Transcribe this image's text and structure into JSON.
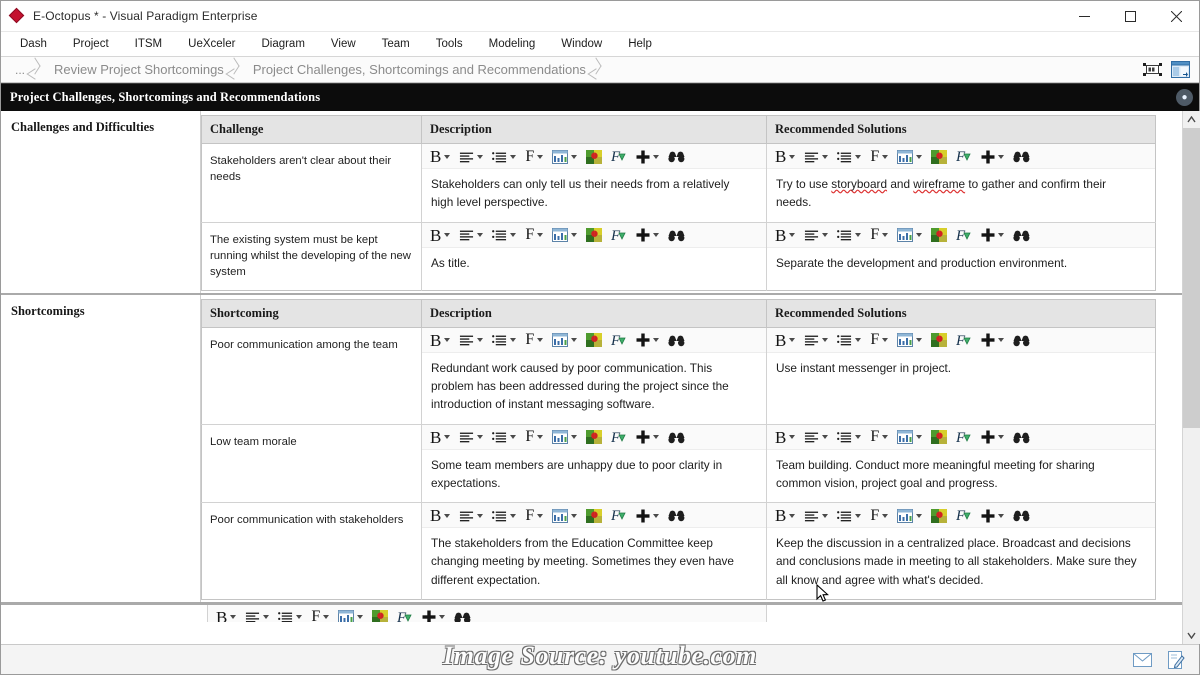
{
  "window": {
    "title": "E-Octopus * - Visual Paradigm Enterprise",
    "logo_icon": "visual-paradigm-diamond-icon",
    "minimize_label": "Minimize",
    "maximize_label": "Maximize",
    "close_label": "Close"
  },
  "menubar": {
    "items": [
      {
        "label": "Dash"
      },
      {
        "label": "Project"
      },
      {
        "label": "ITSM"
      },
      {
        "label": "UeXceler"
      },
      {
        "label": "Diagram"
      },
      {
        "label": "View"
      },
      {
        "label": "Team"
      },
      {
        "label": "Tools"
      },
      {
        "label": "Modeling"
      },
      {
        "label": "Window"
      },
      {
        "label": "Help"
      }
    ]
  },
  "breadcrumb": {
    "items": [
      {
        "label": "..."
      },
      {
        "label": "Review Project Shortcomings"
      },
      {
        "label": "Project Challenges, Shortcomings and Recommendations"
      }
    ],
    "right_icons": [
      {
        "name": "fit-diagram-icon"
      },
      {
        "name": "open-specification-icon"
      }
    ]
  },
  "document": {
    "header_title": "Project Challenges, Shortcomings and Recommendations",
    "pin_icon": "location-pin-icon"
  },
  "toolbar": {
    "buttons": [
      {
        "name": "bold-dropdown",
        "glyph": "B",
        "has_caret": true
      },
      {
        "name": "paragraph-align-dropdown",
        "glyph": "align",
        "has_caret": true
      },
      {
        "name": "list-style-dropdown",
        "glyph": "list",
        "has_caret": true
      },
      {
        "name": "font-dropdown",
        "glyph": "F",
        "has_caret": true
      },
      {
        "name": "insert-table-dropdown",
        "glyph": "table",
        "has_caret": true
      },
      {
        "name": "text-color-button",
        "glyph": "color",
        "has_caret": false
      },
      {
        "name": "format-painter-button",
        "glyph": "fx",
        "has_caret": false
      },
      {
        "name": "insert-dropdown",
        "glyph": "plus",
        "has_caret": true
      },
      {
        "name": "find-button",
        "glyph": "find",
        "has_caret": false
      }
    ]
  },
  "sections": [
    {
      "label": "Challenges and Difficulties",
      "columns": [
        "Challenge",
        "Description",
        "Recommended Solutions"
      ],
      "rows": [
        {
          "item": "Stakeholders aren't clear about their needs",
          "description": "Stakeholders can only tell us their needs from a relatively high level perspective.",
          "solution_pre": "Try to use ",
          "solution_sp1": "storyboard",
          "solution_mid": " and ",
          "solution_sp2": "wireframe",
          "solution_post": " to gather and confirm their needs."
        },
        {
          "item": "The existing system must be kept running whilst the developing of the new system",
          "description": "As title.",
          "solution_pre": "Separate the development and production environment.",
          "solution_sp1": "",
          "solution_mid": "",
          "solution_sp2": "",
          "solution_post": ""
        }
      ]
    },
    {
      "label": "Shortcomings",
      "columns": [
        "Shortcoming",
        "Description",
        "Recommended Solutions"
      ],
      "rows": [
        {
          "item": "Poor communication among the team",
          "description": "Redundant work caused by poor communication. This problem has been addressed during the project since the introduction of instant messaging software.",
          "solution_pre": "Use instant messenger in project.",
          "solution_sp1": "",
          "solution_mid": "",
          "solution_sp2": "",
          "solution_post": ""
        },
        {
          "item": "Low team morale",
          "description": "Some team members are unhappy due to poor clarity in expectations.",
          "solution_pre": "Team building. Conduct more meaningful meeting for sharing common vision, project goal and progress.",
          "solution_sp1": "",
          "solution_mid": "",
          "solution_sp2": "",
          "solution_post": ""
        },
        {
          "item": "Poor communication with stakeholders",
          "description": "The stakeholders from the Education Committee keep changing meeting by meeting. Sometimes they even have different expectation.",
          "solution_pre": "Keep the discussion in a centralized place. Broadcast and decisions and conclusions made in meeting to all stakeholders. Make sure they all know and agree with what's decided.",
          "solution_sp1": "",
          "solution_mid": "",
          "solution_sp2": "",
          "solution_post": ""
        }
      ]
    }
  ],
  "statusbar": {
    "icons": [
      {
        "name": "message-icon"
      },
      {
        "name": "compose-note-icon"
      }
    ]
  },
  "watermark": {
    "text": "Image Source: youtube.com"
  },
  "scrollbar": {
    "up_label": "Scroll up",
    "down_label": "Scroll down"
  }
}
